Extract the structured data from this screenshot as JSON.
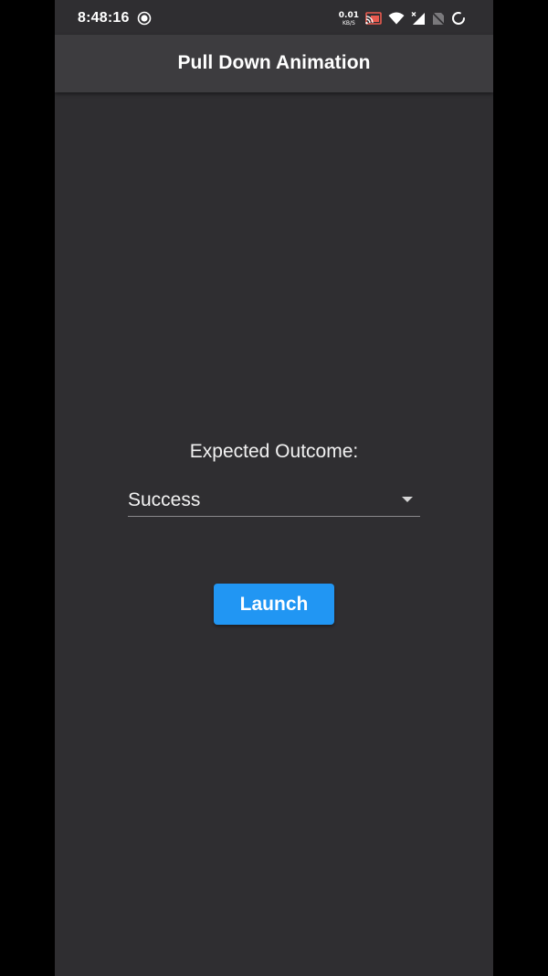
{
  "status_bar": {
    "time": "8:48:16",
    "net_speed_value": "0.01",
    "net_speed_unit": "KB/S",
    "icons": [
      "record-icon",
      "cast-icon",
      "wifi-icon",
      "signal-icon",
      "no-sim-icon",
      "loading-icon"
    ]
  },
  "app_bar": {
    "title": "Pull Down Animation"
  },
  "form": {
    "label": "Expected Outcome:",
    "selected_value": "Success",
    "launch_label": "Launch"
  },
  "colors": {
    "background": "#2f2e31",
    "app_bar": "#3d3c3f",
    "accent": "#2196f3"
  }
}
